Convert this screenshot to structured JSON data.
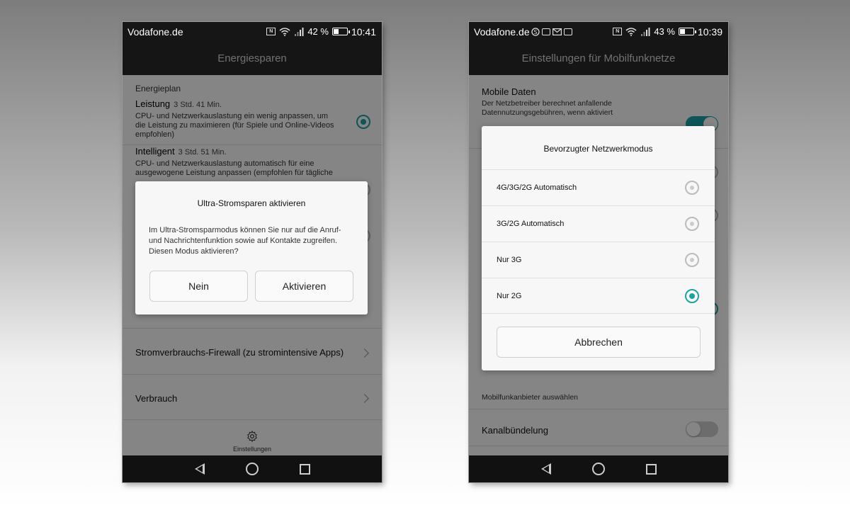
{
  "left": {
    "status": {
      "carrier": "Vodafone.de",
      "battery": "42 %",
      "battery_level": 0.42,
      "time": "10:41"
    },
    "appbar_title": "Energiesparen",
    "section_label": "Energieplan",
    "plans": [
      {
        "title": "Leistung",
        "time": "3 Std. 41 Min.",
        "desc": "CPU- und Netzwerkauslastung ein wenig anpassen, um die Leistung zu maximieren (für Spiele und Online-Videos empfohlen)",
        "selected": true
      },
      {
        "title": "Intelligent",
        "time": "3 Std. 51 Min.",
        "desc": "CPU- und Netzwerkauslastung automatisch für eine ausgewogene Leistung anpassen (empfohlen für tägliche",
        "selected": false
      }
    ],
    "rows": [
      "Stromverbrauchs-Firewall (zu stromintensive Apps)",
      "Verbrauch"
    ],
    "footer_label": "Einstellungen",
    "dialog": {
      "title": "Ultra-Stromsparen aktivieren",
      "body": "Im Ultra-Stromsparmodus können Sie nur auf die Anruf- und Nachrichtenfunktion sowie auf Kontakte zugreifen. Diesen Modus aktivieren?",
      "no_label": "Nein",
      "yes_label": "Aktivieren"
    }
  },
  "right": {
    "status": {
      "carrier": "Vodafone.de",
      "battery": "43 %",
      "battery_level": 0.43,
      "time": "10:39"
    },
    "appbar_title": "Einstellungen für Mobilfunknetze",
    "mobile_data": {
      "title": "Mobile Daten",
      "desc": "Der Netzbetreiber berechnet anfallende Datennutzungsgebühren, wenn aktiviert",
      "enabled": true
    },
    "provider_hint": "Mobilfunkanbieter auswählen",
    "channel_bundling": {
      "title": "Kanalbündelung",
      "enabled": false
    },
    "dialog": {
      "title": "Bevorzugter Netzwerkmodus",
      "options": [
        {
          "label": "4G/3G/2G Automatisch",
          "selected": false
        },
        {
          "label": "3G/2G Automatisch",
          "selected": false
        },
        {
          "label": "Nur 3G",
          "selected": false
        },
        {
          "label": "Nur 2G",
          "selected": true
        }
      ],
      "cancel_label": "Abbrechen"
    }
  },
  "colors": {
    "accent": "#1aa3a6",
    "appbar": "#2a2a2a",
    "statusbar": "#161616"
  }
}
